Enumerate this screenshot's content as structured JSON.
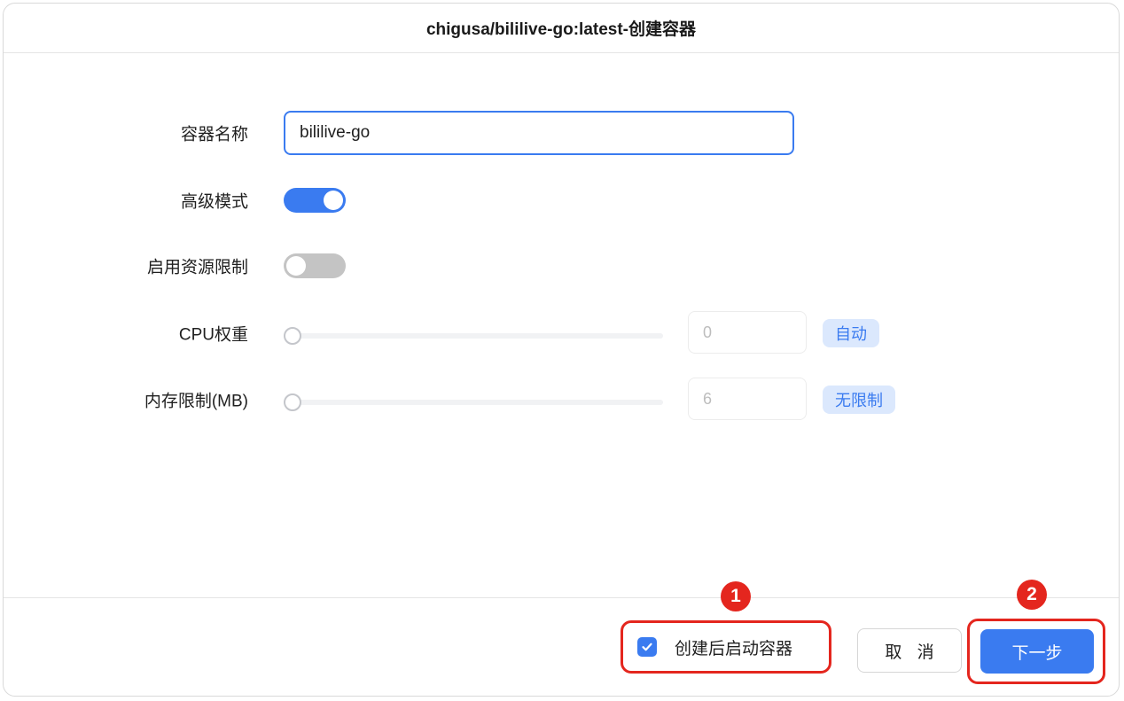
{
  "dialog": {
    "title": "chigusa/bililive-go:latest-创建容器"
  },
  "form": {
    "container_name": {
      "label": "容器名称",
      "value": "bililive-go"
    },
    "advanced_mode": {
      "label": "高级模式",
      "enabled": true
    },
    "resource_limit": {
      "label": "启用资源限制",
      "enabled": false
    },
    "cpu_weight": {
      "label": "CPU权重",
      "value": "0",
      "slider_fraction": 0,
      "tag": "自动"
    },
    "memory_limit": {
      "label": "内存限制(MB)",
      "value": "6",
      "slider_fraction": 0,
      "tag": "无限制"
    }
  },
  "footer": {
    "start_after_create": {
      "label": "创建后启动容器",
      "checked": true
    },
    "cancel_label": "取 消",
    "next_label": "下一步"
  },
  "annotations": {
    "badge_1": "1",
    "badge_2": "2"
  },
  "colors": {
    "accent": "#3a7bf0",
    "annotation_red": "#e4261e",
    "toggle_off": "#c4c4c4",
    "tag_bg": "#dbe8fd"
  },
  "icons": {
    "checkbox": "checkmark-icon"
  }
}
